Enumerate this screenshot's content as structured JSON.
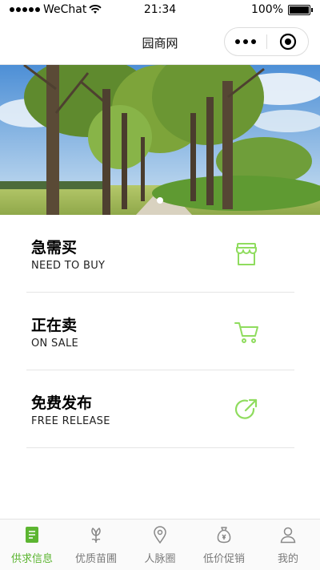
{
  "status_bar": {
    "carrier": "WeChat",
    "time": "21:34",
    "battery": "100%"
  },
  "nav": {
    "title": "园商网"
  },
  "colors": {
    "accent": "#5cb531",
    "icon_green": "#8fdc5e",
    "divider": "#e5e5e5"
  },
  "menu": {
    "items": [
      {
        "title": "急需买",
        "subtitle": "NEED TO BUY",
        "icon": "store-icon"
      },
      {
        "title": "正在卖",
        "subtitle": "ON SALE",
        "icon": "cart-icon"
      },
      {
        "title": "免费发布",
        "subtitle": "FREE RELEASE",
        "icon": "share-arrow-icon"
      }
    ]
  },
  "tabs": [
    {
      "label": "供求信息",
      "icon": "document-icon",
      "active": true
    },
    {
      "label": "优质苗圃",
      "icon": "plant-icon",
      "active": false
    },
    {
      "label": "人脉圈",
      "icon": "location-pin-icon",
      "active": false
    },
    {
      "label": "低价促销",
      "icon": "money-bag-icon",
      "active": false
    },
    {
      "label": "我的",
      "icon": "user-icon",
      "active": false
    }
  ]
}
